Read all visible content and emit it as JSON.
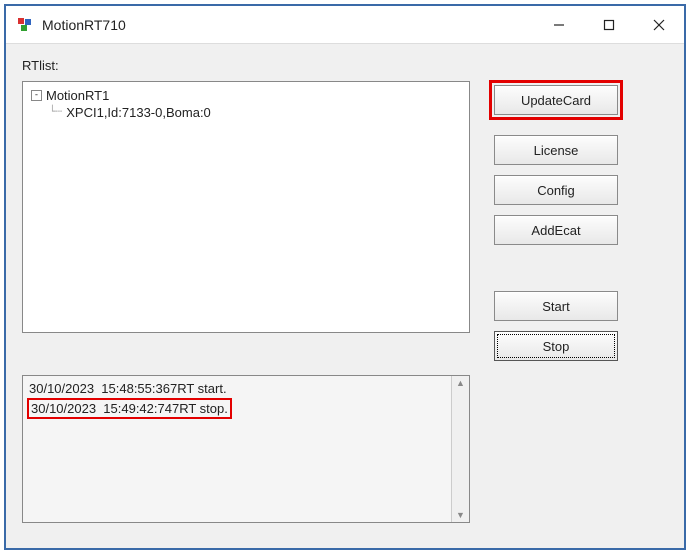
{
  "window": {
    "title": "MotionRT710"
  },
  "labels": {
    "rtlist": "RTlist:"
  },
  "tree": {
    "root": "MotionRT1",
    "toggle": "-",
    "child": "XPCI1,Id:7133-0,Boma:0"
  },
  "buttons": {
    "updateCard": "UpdateCard",
    "license": "License",
    "config": "Config",
    "addEcat": "AddEcat",
    "start": "Start",
    "stop": "Stop"
  },
  "log": {
    "lines": [
      "30/10/2023  15:48:55:367RT start.",
      "30/10/2023  15:49:42:747RT stop."
    ]
  }
}
